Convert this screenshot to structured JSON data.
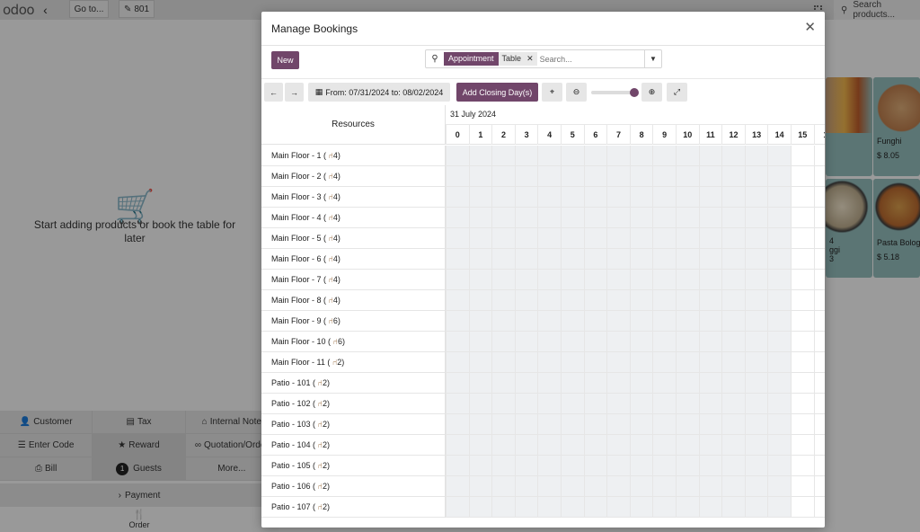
{
  "pos": {
    "logo": "odoo",
    "goto_label": "Go to...",
    "order_label": "801",
    "search_products_placeholder": "Search products...",
    "empty_message": "Start adding products or book the table for later",
    "controls_row1": [
      "Customer",
      "Tax",
      "Internal Note"
    ],
    "controls_row2": [
      "Enter Code",
      "Reward",
      "Quotation/Order"
    ],
    "controls_row3": {
      "bill": "Bill",
      "guests_count": "1",
      "guests": "Guests",
      "more": "More..."
    },
    "payment_label": "Payment",
    "order_tab_label": "Order",
    "products": [
      {
        "name": "",
        "price": ""
      },
      {
        "name": "Funghi",
        "price": "$ 8.05"
      },
      {
        "name": "4\nggi",
        "price": "3"
      },
      {
        "name": "Pasta Bolog",
        "price": "$ 5.18"
      }
    ]
  },
  "modal": {
    "title": "Manage Bookings",
    "new_label": "New",
    "search": {
      "facet_label": "Appointment",
      "facet_value": "Table",
      "placeholder": "Search..."
    },
    "date_range": "From: 07/31/2024 to: 08/02/2024",
    "add_closing_label": "Add Closing Day(s)",
    "zoom_level": 0.95,
    "gantt": {
      "resources_header": "Resources",
      "date_label": "31 July 2024",
      "hours": [
        "0",
        "1",
        "2",
        "3",
        "4",
        "5",
        "6",
        "7",
        "8",
        "9",
        "10",
        "11",
        "12",
        "13",
        "14",
        "15",
        "1"
      ],
      "rows": [
        {
          "name": "Main Floor - 1 (",
          "seats": "4)"
        },
        {
          "name": "Main Floor - 2 (",
          "seats": "4)"
        },
        {
          "name": "Main Floor - 3 (",
          "seats": "4)"
        },
        {
          "name": "Main Floor - 4 (",
          "seats": "4)"
        },
        {
          "name": "Main Floor - 5 (",
          "seats": "4)"
        },
        {
          "name": "Main Floor - 6 (",
          "seats": "4)"
        },
        {
          "name": "Main Floor - 7 (",
          "seats": "4)"
        },
        {
          "name": "Main Floor - 8 (",
          "seats": "4)"
        },
        {
          "name": "Main Floor - 9 (",
          "seats": "6)"
        },
        {
          "name": "Main Floor - 10 (",
          "seats": "6)"
        },
        {
          "name": "Main Floor - 11 (",
          "seats": "2)"
        },
        {
          "name": "Patio - 101 (",
          "seats": "2)"
        },
        {
          "name": "Patio - 102 (",
          "seats": "2)"
        },
        {
          "name": "Patio - 103 (",
          "seats": "2)"
        },
        {
          "name": "Patio - 104 (",
          "seats": "2)"
        },
        {
          "name": "Patio - 105 (",
          "seats": "2)"
        },
        {
          "name": "Patio - 106 (",
          "seats": "2)"
        },
        {
          "name": "Patio - 107 (",
          "seats": "2)"
        }
      ]
    }
  },
  "colors": {
    "primary": "#71466a",
    "grid_cell": "#eef0f2",
    "product_card": "#8fb7b6"
  }
}
